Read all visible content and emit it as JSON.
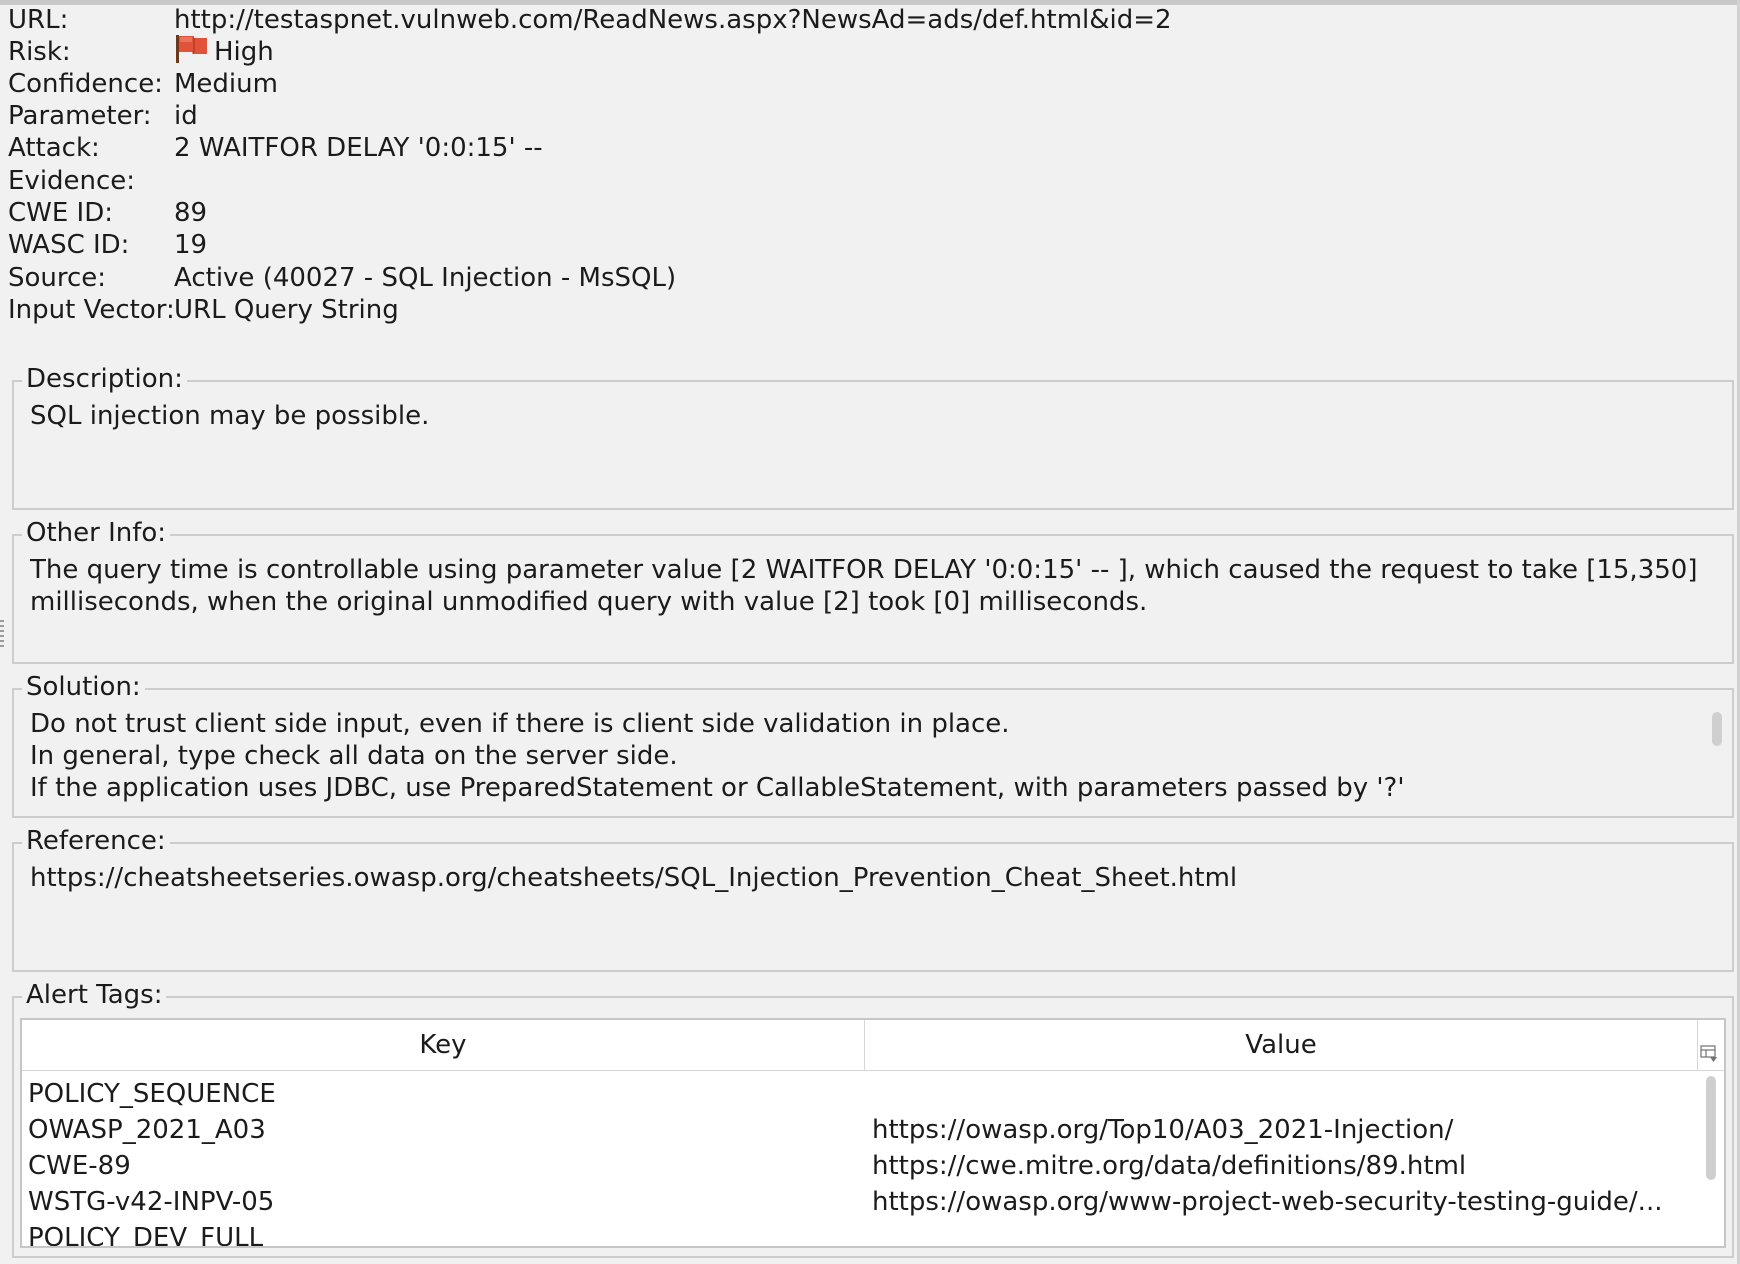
{
  "alert": {
    "fields": [
      {
        "label": "URL:",
        "value": "http://testaspnet.vulnweb.com/ReadNews.aspx?NewsAd=ads/def.html&id=2"
      },
      {
        "label": "Risk:",
        "value": "High"
      },
      {
        "label": "Confidence:",
        "value": "Medium"
      },
      {
        "label": "Parameter:",
        "value": "id"
      },
      {
        "label": "Attack:",
        "value": "2 WAITFOR DELAY '0:0:15' --"
      },
      {
        "label": "Evidence:",
        "value": ""
      },
      {
        "label": "CWE ID:",
        "value": "89"
      },
      {
        "label": "WASC ID:",
        "value": "19"
      },
      {
        "label": "Source:",
        "value": "Active (40027 - SQL Injection - MsSQL)"
      },
      {
        "label": "Input Vector:",
        "value": "URL Query String"
      }
    ],
    "risk_flag_icon": "flag-icon",
    "risk_color": "#e0533a",
    "description": {
      "title": "Description:",
      "lines": [
        "SQL injection may be possible."
      ]
    },
    "other_info": {
      "title": "Other Info:",
      "lines": [
        "The query time is controllable using parameter value [2 WAITFOR DELAY '0:0:15' -- ], which caused the request to take [15,350]",
        "milliseconds, when the original unmodified query with value [2] took [0] milliseconds."
      ]
    },
    "solution": {
      "title": "Solution:",
      "lines": [
        "Do not trust client side input, even if there is client side validation in place.",
        "In general, type check all data on the server side.",
        "If the application uses JDBC, use PreparedStatement or CallableStatement, with parameters passed by '?'"
      ]
    },
    "reference": {
      "title": "Reference:",
      "lines": [
        "https://cheatsheetseries.owasp.org/cheatsheets/SQL_Injection_Prevention_Cheat_Sheet.html"
      ]
    },
    "alert_tags": {
      "title": "Alert Tags:",
      "columns": [
        "Key",
        "Value"
      ],
      "rows": [
        {
          "key": "POLICY_SEQUENCE",
          "value": ""
        },
        {
          "key": "OWASP_2021_A03",
          "value": "https://owasp.org/Top10/A03_2021-Injection/"
        },
        {
          "key": "CWE-89",
          "value": "https://cwe.mitre.org/data/definitions/89.html"
        },
        {
          "key": "WSTG-v42-INPV-05",
          "value": "https://owasp.org/www-project-web-security-testing-guide/..."
        },
        {
          "key": "POLICY_DEV_FULL",
          "value": ""
        }
      ]
    }
  }
}
